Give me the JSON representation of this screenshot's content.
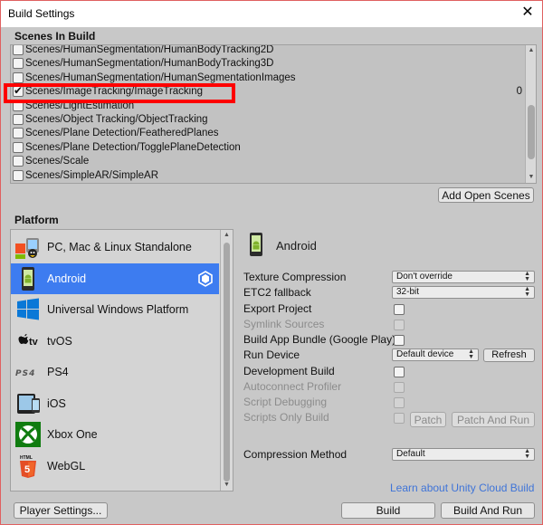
{
  "window": {
    "title": "Build Settings",
    "close_glyph": "✕"
  },
  "scenes": {
    "label": "Scenes In Build",
    "items": [
      {
        "path": "Scenes/HumanSegmentation/HumanBodyTracking2D",
        "checked": false,
        "index": ""
      },
      {
        "path": "Scenes/HumanSegmentation/HumanBodyTracking3D",
        "checked": false,
        "index": ""
      },
      {
        "path": "Scenes/HumanSegmentation/HumanSegmentationImages",
        "checked": false,
        "index": ""
      },
      {
        "path": "Scenes/ImageTracking/ImageTracking",
        "checked": true,
        "index": "0"
      },
      {
        "path": "Scenes/LightEstimation",
        "checked": false,
        "index": ""
      },
      {
        "path": "Scenes/Object Tracking/ObjectTracking",
        "checked": false,
        "index": ""
      },
      {
        "path": "Scenes/Plane Detection/FeatheredPlanes",
        "checked": false,
        "index": ""
      },
      {
        "path": "Scenes/Plane Detection/TogglePlaneDetection",
        "checked": false,
        "index": ""
      },
      {
        "path": "Scenes/Scale",
        "checked": false,
        "index": ""
      },
      {
        "path": "Scenes/SimpleAR/SimpleAR",
        "checked": false,
        "index": ""
      }
    ],
    "add_open_scenes": "Add Open Scenes",
    "highlight_color": "#ff0000"
  },
  "platform": {
    "label": "Platform",
    "items": [
      {
        "label": "PC, Mac & Linux Standalone",
        "icon": "pc-mac-linux-icon",
        "selected": false
      },
      {
        "label": "Android",
        "icon": "android-icon",
        "selected": true,
        "badge": "unity-logo-icon"
      },
      {
        "label": "Universal Windows Platform",
        "icon": "windows-icon",
        "selected": false
      },
      {
        "label": "tvOS",
        "icon": "apple-tv-icon",
        "selected": false
      },
      {
        "label": "PS4",
        "icon": "ps4-icon",
        "selected": false
      },
      {
        "label": "iOS",
        "icon": "ios-device-icon",
        "selected": false
      },
      {
        "label": "Xbox One",
        "icon": "xbox-icon",
        "selected": false
      },
      {
        "label": "WebGL",
        "icon": "html5-icon",
        "selected": false
      }
    ],
    "selected_color": "#3d7cf0"
  },
  "settings": {
    "header": "Android",
    "texture_compression": {
      "label": "Texture Compression",
      "value": "Don't override"
    },
    "etc2_fallback": {
      "label": "ETC2 fallback",
      "value": "32-bit"
    },
    "export_project": {
      "label": "Export Project",
      "checked": false
    },
    "symlink_sources": {
      "label": "Symlink Sources",
      "checked": false,
      "disabled": true
    },
    "build_app_bundle": {
      "label": "Build App Bundle (Google Play)",
      "checked": false
    },
    "run_device": {
      "label": "Run Device",
      "value": "Default device",
      "refresh": "Refresh"
    },
    "development_build": {
      "label": "Development Build",
      "checked": false
    },
    "autoconnect_profiler": {
      "label": "Autoconnect Profiler",
      "checked": false,
      "disabled": true
    },
    "script_debugging": {
      "label": "Script Debugging",
      "checked": false,
      "disabled": true
    },
    "scripts_only_build": {
      "label": "Scripts Only Build",
      "checked": false,
      "disabled": true,
      "patch": "Patch",
      "patch_and_run": "Patch And Run"
    },
    "compression_method": {
      "label": "Compression Method",
      "value": "Default"
    }
  },
  "footer": {
    "cloud_link": "Learn about Unity Cloud Build",
    "player_settings": "Player Settings...",
    "build": "Build",
    "build_and_run": "Build And Run"
  },
  "logo_text": {
    "tv": "tv",
    "ps4": "PS4",
    "html5": "HTML"
  }
}
